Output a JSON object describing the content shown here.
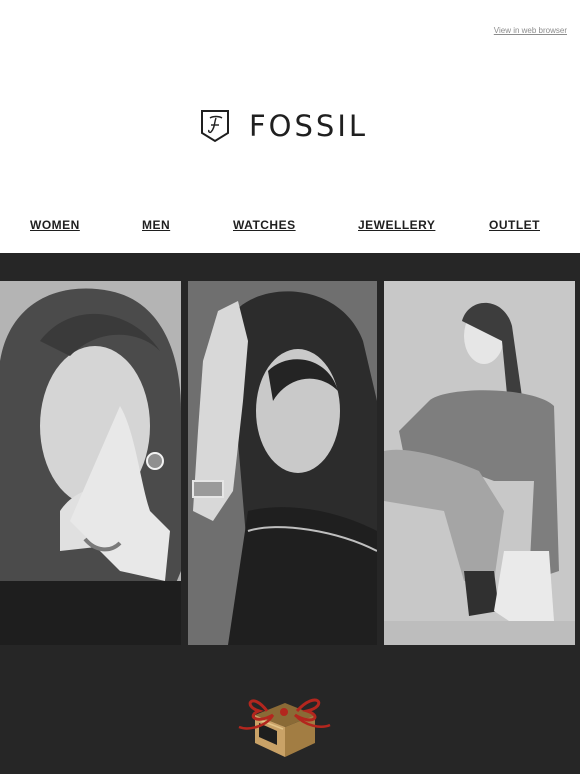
{
  "header": {
    "web_link": "View in web browser"
  },
  "brand": {
    "name": "FOSSIL",
    "logo_mark": "F",
    "logo_icon": "fossil-shield-logo"
  },
  "nav": {
    "items": [
      {
        "label": "WOMEN"
      },
      {
        "label": "MEN"
      },
      {
        "label": "WATCHES"
      },
      {
        "label": "JEWELLERY"
      },
      {
        "label": "OUTLET"
      }
    ]
  },
  "hero": {
    "photos": [
      {
        "subject": "woman-laughing-covering-face-with-ring"
      },
      {
        "subject": "woman-with-wristwatch-hand-raised"
      },
      {
        "subject": "woman-seated-in-sweater-and-jeans"
      }
    ]
  },
  "gift": {
    "icon": "gift-box-icon",
    "ribbon_color": "#b3261e",
    "box_color": "#b89152"
  },
  "colors": {
    "dark_panel": "#262626",
    "text": "#1f1f1f",
    "link_gray": "#8c8c8c"
  }
}
